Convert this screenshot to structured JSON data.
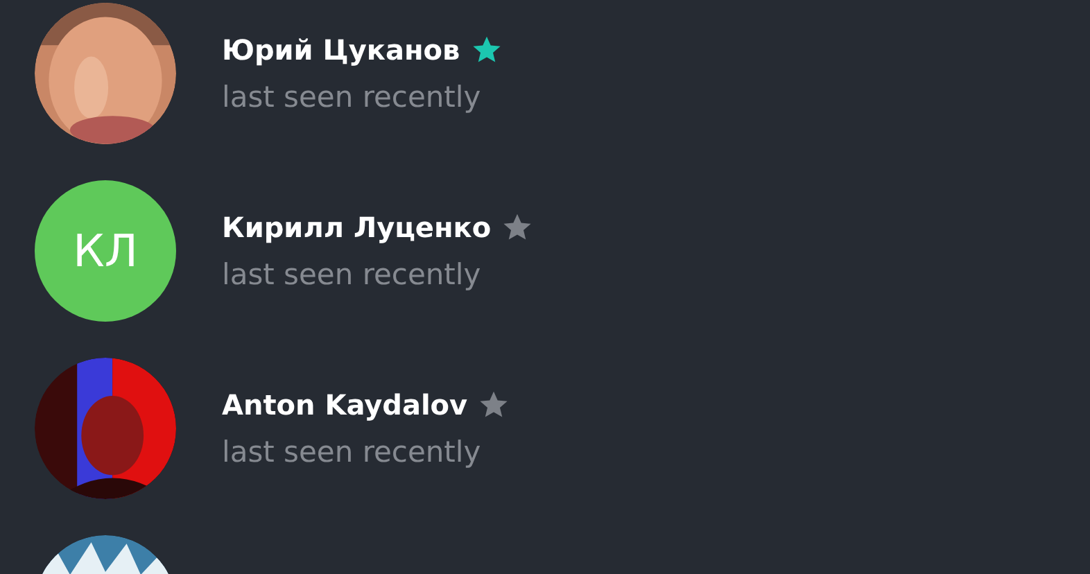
{
  "contacts": [
    {
      "avatar": {
        "kind": "picture"
      },
      "name": "Юрий Цуканов",
      "starred": true,
      "status": "last seen recently"
    },
    {
      "avatar": {
        "kind": "initials",
        "initials": "КЛ",
        "color": "#5fc95a"
      },
      "name": "Кирилл Луценко",
      "starred": false,
      "status": "last seen recently"
    },
    {
      "avatar": {
        "kind": "picture"
      },
      "name": "Anton Kaydalov",
      "starred": false,
      "status": "last seen recently"
    },
    {
      "avatar": {
        "kind": "picture"
      }
    }
  ]
}
